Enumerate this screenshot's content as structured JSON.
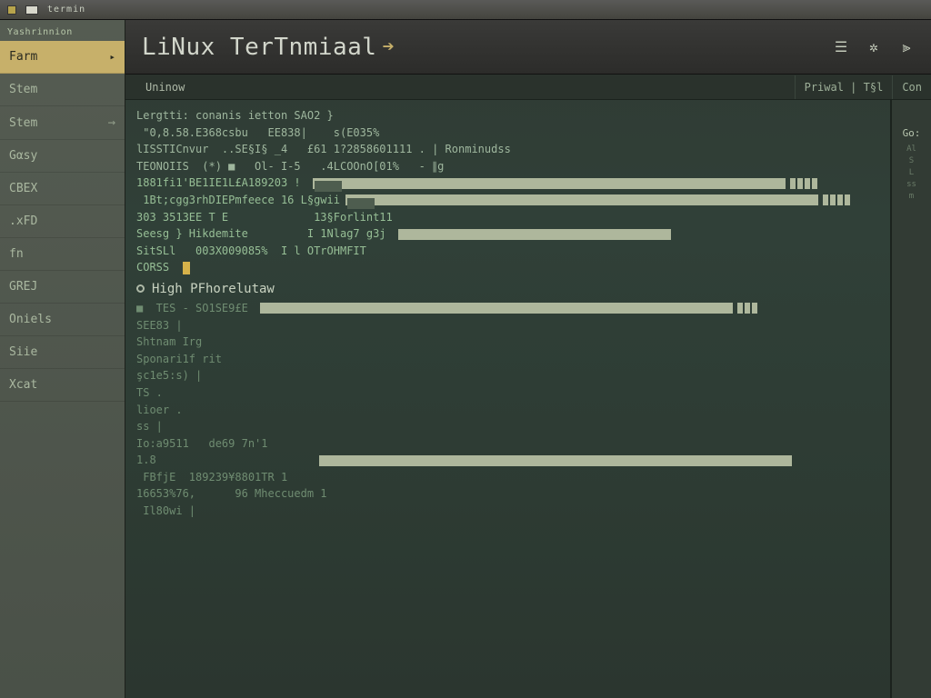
{
  "window": {
    "title": "termin"
  },
  "sidebar": {
    "header": "Yashrinnion",
    "items": [
      {
        "label": "Farm",
        "active": true,
        "hasCaret": true
      },
      {
        "label": "Stem"
      },
      {
        "label": "Stem",
        "hasArrow": true
      },
      {
        "label": "Gαsy"
      },
      {
        "label": "CBEX"
      },
      {
        "label": ".xFD"
      },
      {
        "label": "fn"
      },
      {
        "label": "GREJ"
      },
      {
        "label": "Oniels"
      },
      {
        "label": "Siie"
      },
      {
        "label": "Xcat"
      }
    ]
  },
  "titlebar": {
    "title": "LiNux TerTnmiaal",
    "icons": [
      "stack",
      "gear",
      "meter"
    ]
  },
  "tabs": {
    "left": "Uninow",
    "right": [
      "Priwal | T§l",
      "Con"
    ]
  },
  "rightpanel": {
    "head": "Go:",
    "rows": [
      "Al",
      "S",
      "L",
      "ss",
      "",
      "m",
      ""
    ]
  },
  "terminal": {
    "lines": [
      "Lergtti: conanis ietton SAO2 }",
      " \"0,8.58.E368csbu   EE838|    s(E035%  ",
      "lISSTICnvur  ..SE§I§ _4   £61 1?2858601111 . | Ronminudss",
      "TEONOIIS  (*) ■   Ol- I-5   .4LCOOnO[01%   - ∥g",
      "",
      "1881fi1'BE1IE1L£A189203 ! ",
      " 1Bt;cgg3rhDIEPmfeece 16 L§gwii",
      "303 3513EE T E             13§Forlint11",
      "Seesg } Hikdemite         I 1Nlag7 g3j ",
      "SitSLl   003X009085%  I l OTrOHMFIT",
      "CORSS"
    ],
    "section_header": "High PFhorelutaw",
    "section_lines": [
      "■  TES - SO1SE9£E ",
      "SEE83 |",
      "Shtnam Irg",
      "Sponari1f rit",
      "şc1e5:s) |",
      "TS .",
      "lioer .",
      "ss |",
      "Io:a9511   de69 7n'1",
      "1.8                        ",
      " FBfjE  189239¥8801TR 1",
      "16653%76,      96 Mheccuedm 1",
      " Il80wi |"
    ]
  }
}
